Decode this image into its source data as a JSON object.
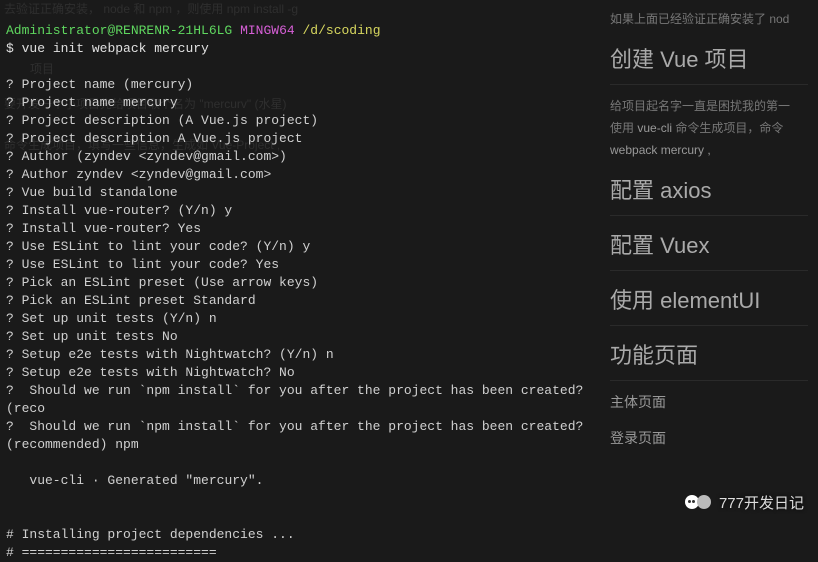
{
  "ghosts": {
    "g1": "去验证正确安装， node    和    npm ，则使用   npm install -g",
    "g2": "项目",
    "g3": "要开发一个小项目先给项目取个名为  \"mercurv\" (水星)",
    "g4": "命令生成项目，填写一些信息，生成如 Vue-Project ,"
  },
  "prompt": {
    "user_host": "Administrator@RENRENR-21HL6LG",
    "shell": "MINGW64",
    "cwd": "/d/scoding",
    "dollar": "$",
    "cmd": "vue init webpack mercury"
  },
  "lines": [
    "? Project name (mercury)",
    "? Project name mercury",
    "? Project description (A Vue.js project)",
    "? Project description A Vue.js project",
    "? Author (zyndev <zyndev@gmail.com>)",
    "? Author zyndev <zyndev@gmail.com>",
    "? Vue build standalone",
    "? Install vue-router? (Y/n) y",
    "? Install vue-router? Yes",
    "? Use ESLint to lint your code? (Y/n) y",
    "? Use ESLint to lint your code? Yes",
    "? Pick an ESLint preset (Use arrow keys)",
    "? Pick an ESLint preset Standard",
    "? Set up unit tests (Y/n) n",
    "? Set up unit tests No",
    "? Setup e2e tests with Nightwatch? (Y/n) n",
    "? Setup e2e tests with Nightwatch? No",
    "?  Should we run `npm install` for you after the project has been created? (reco",
    "?  Should we run `npm install` for you after the project has been created? (recommended) npm",
    "",
    "   vue-cli · Generated \"mercury\".",
    "",
    "",
    "# Installing project dependencies ...",
    "# ========================="
  ],
  "sidebar": {
    "top_note": "如果上面已经验证正确安装了 nod",
    "h_create": "创建 Vue 项目",
    "note1": "给项目起名字一直是困扰我的第一",
    "note2a": "使用 ",
    "note2b": "vue-cli",
    "note2c": " 命令生成项目，命令",
    "note3": "webpack mercury ,",
    "h_axios": "配置 axios",
    "h_vuex": "配置 Vuex",
    "h_element": "使用 elementUI",
    "h_func": "功能页面",
    "sub1": "主体页面",
    "sub2": "登录页面"
  },
  "watermark": "777开发日记"
}
